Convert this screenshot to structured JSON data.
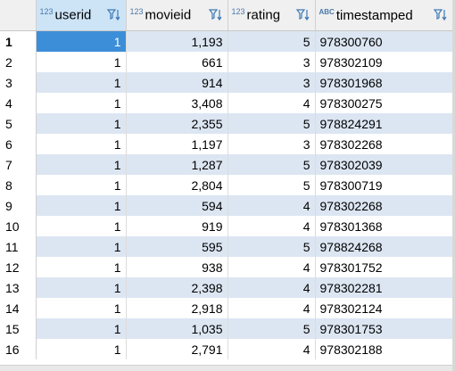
{
  "columns": [
    {
      "name": "userid",
      "type_label": "123",
      "align": "num"
    },
    {
      "name": "movieid",
      "type_label": "123",
      "align": "num"
    },
    {
      "name": "rating",
      "type_label": "123",
      "align": "num"
    },
    {
      "name": "timestamped",
      "type_label": "ABC",
      "align": "txt"
    }
  ],
  "sort_icon": "sort-filter-icon",
  "rows": [
    {
      "n": "1",
      "cells": [
        "1",
        "1,193",
        "5",
        "978300760"
      ]
    },
    {
      "n": "2",
      "cells": [
        "1",
        "661",
        "3",
        "978302109"
      ]
    },
    {
      "n": "3",
      "cells": [
        "1",
        "914",
        "3",
        "978301968"
      ]
    },
    {
      "n": "4",
      "cells": [
        "1",
        "3,408",
        "4",
        "978300275"
      ]
    },
    {
      "n": "5",
      "cells": [
        "1",
        "2,355",
        "5",
        "978824291"
      ]
    },
    {
      "n": "6",
      "cells": [
        "1",
        "1,197",
        "3",
        "978302268"
      ]
    },
    {
      "n": "7",
      "cells": [
        "1",
        "1,287",
        "5",
        "978302039"
      ]
    },
    {
      "n": "8",
      "cells": [
        "1",
        "2,804",
        "5",
        "978300719"
      ]
    },
    {
      "n": "9",
      "cells": [
        "1",
        "594",
        "4",
        "978302268"
      ]
    },
    {
      "n": "10",
      "cells": [
        "1",
        "919",
        "4",
        "978301368"
      ]
    },
    {
      "n": "11",
      "cells": [
        "1",
        "595",
        "5",
        "978824268"
      ]
    },
    {
      "n": "12",
      "cells": [
        "1",
        "938",
        "4",
        "978301752"
      ]
    },
    {
      "n": "13",
      "cells": [
        "1",
        "2,398",
        "4",
        "978302281"
      ]
    },
    {
      "n": "14",
      "cells": [
        "1",
        "2,918",
        "4",
        "978302124"
      ]
    },
    {
      "n": "15",
      "cells": [
        "1",
        "1,035",
        "5",
        "978301753"
      ]
    },
    {
      "n": "16",
      "cells": [
        "1",
        "2,791",
        "4",
        "978302188"
      ]
    }
  ],
  "colors": {
    "selected_cell": "#3d8ed8",
    "stripe": "#dce6f2",
    "type_label": "#4a79a8"
  }
}
